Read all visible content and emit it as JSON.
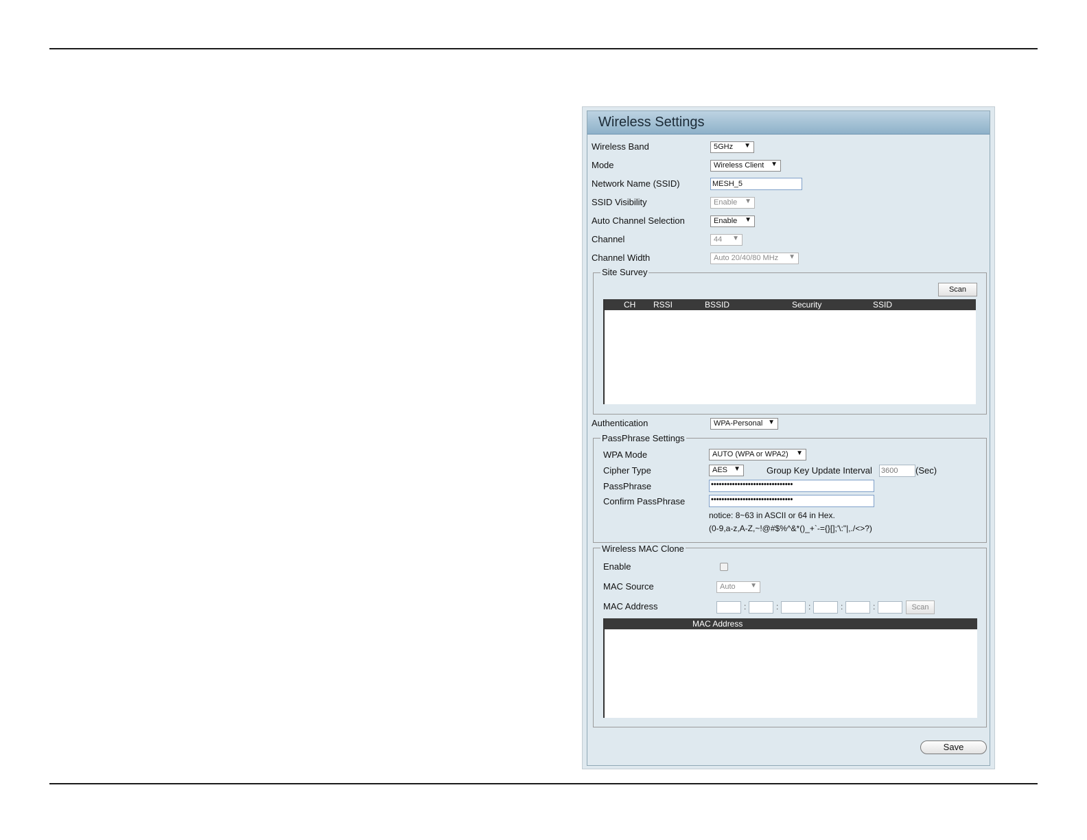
{
  "panel": {
    "title": "Wireless Settings"
  },
  "fields": {
    "wireless_band": {
      "label": "Wireless Band",
      "value": "5GHz"
    },
    "mode": {
      "label": "Mode",
      "value": "Wireless Client"
    },
    "ssid": {
      "label": "Network Name (SSID)",
      "value": "MESH_5"
    },
    "ssid_visibility": {
      "label": "SSID Visibility",
      "value": "Enable"
    },
    "auto_channel": {
      "label": "Auto Channel Selection",
      "value": "Enable"
    },
    "channel": {
      "label": "Channel",
      "value": "44"
    },
    "channel_width": {
      "label": "Channel Width",
      "value": "Auto 20/40/80 MHz"
    },
    "authentication": {
      "label": "Authentication",
      "value": "WPA-Personal"
    }
  },
  "site_survey": {
    "legend": "Site Survey",
    "scan_label": "Scan",
    "columns": [
      "CH",
      "RSSI",
      "BSSID",
      "Security",
      "SSID"
    ]
  },
  "passphrase": {
    "legend": "PassPhrase Settings",
    "wpa_mode": {
      "label": "WPA Mode",
      "value": "AUTO (WPA or WPA2)"
    },
    "cipher_type": {
      "label": "Cipher Type",
      "value": "AES"
    },
    "group_key": {
      "label": "Group Key Update Interval",
      "value": "3600",
      "unit": "(Sec)"
    },
    "passphrase": {
      "label": "PassPhrase",
      "value": "•••••••••••••••••••••••••••••••"
    },
    "confirm": {
      "label": "Confirm PassPhrase",
      "value": "•••••••••••••••••••••••••••••••"
    },
    "notice1": "notice: 8~63 in ASCII or 64 in Hex.",
    "notice2": "(0-9,a-z,A-Z,~!@#$%^&*()_+`-={}[];'\\:\"|,./<>?)"
  },
  "mac_clone": {
    "legend": "Wireless MAC Clone",
    "enable": {
      "label": "Enable",
      "checked": false
    },
    "mac_source": {
      "label": "MAC Source",
      "value": "Auto"
    },
    "mac_address": {
      "label": "MAC Address"
    },
    "scan_label": "Scan",
    "table_header": "MAC Address"
  },
  "save_label": "Save",
  "icons": {
    "dropdown_arrow": "▼"
  }
}
